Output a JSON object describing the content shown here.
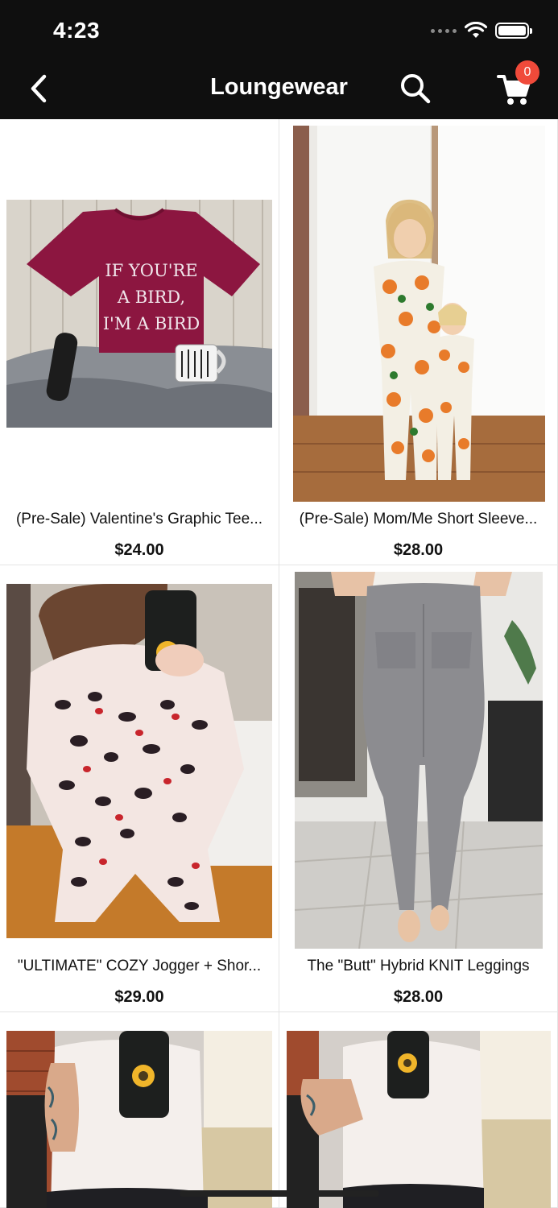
{
  "status_bar": {
    "time": "4:23"
  },
  "nav": {
    "title": "Loungewear",
    "cart_count": "0"
  },
  "products": [
    {
      "title": "(Pre-Sale) Valentine's Graphic Tee...",
      "price": "$24.00",
      "image_text": "IF YOU'RE A BIRD, I'M A BIRD"
    },
    {
      "title": "(Pre-Sale) Mom/Me Short Sleeve...",
      "price": "$28.00"
    },
    {
      "title": "\"ULTIMATE\" COZY Jogger + Shor...",
      "price": "$29.00"
    },
    {
      "title": "The \"Butt\" Hybrid KNIT Leggings",
      "price": "$28.00"
    },
    {
      "title": "",
      "price": ""
    },
    {
      "title": "",
      "price": ""
    }
  ],
  "colors": {
    "header_bg": "#0f0f0f",
    "badge": "#f04a3a",
    "tee": "#8c1640"
  }
}
